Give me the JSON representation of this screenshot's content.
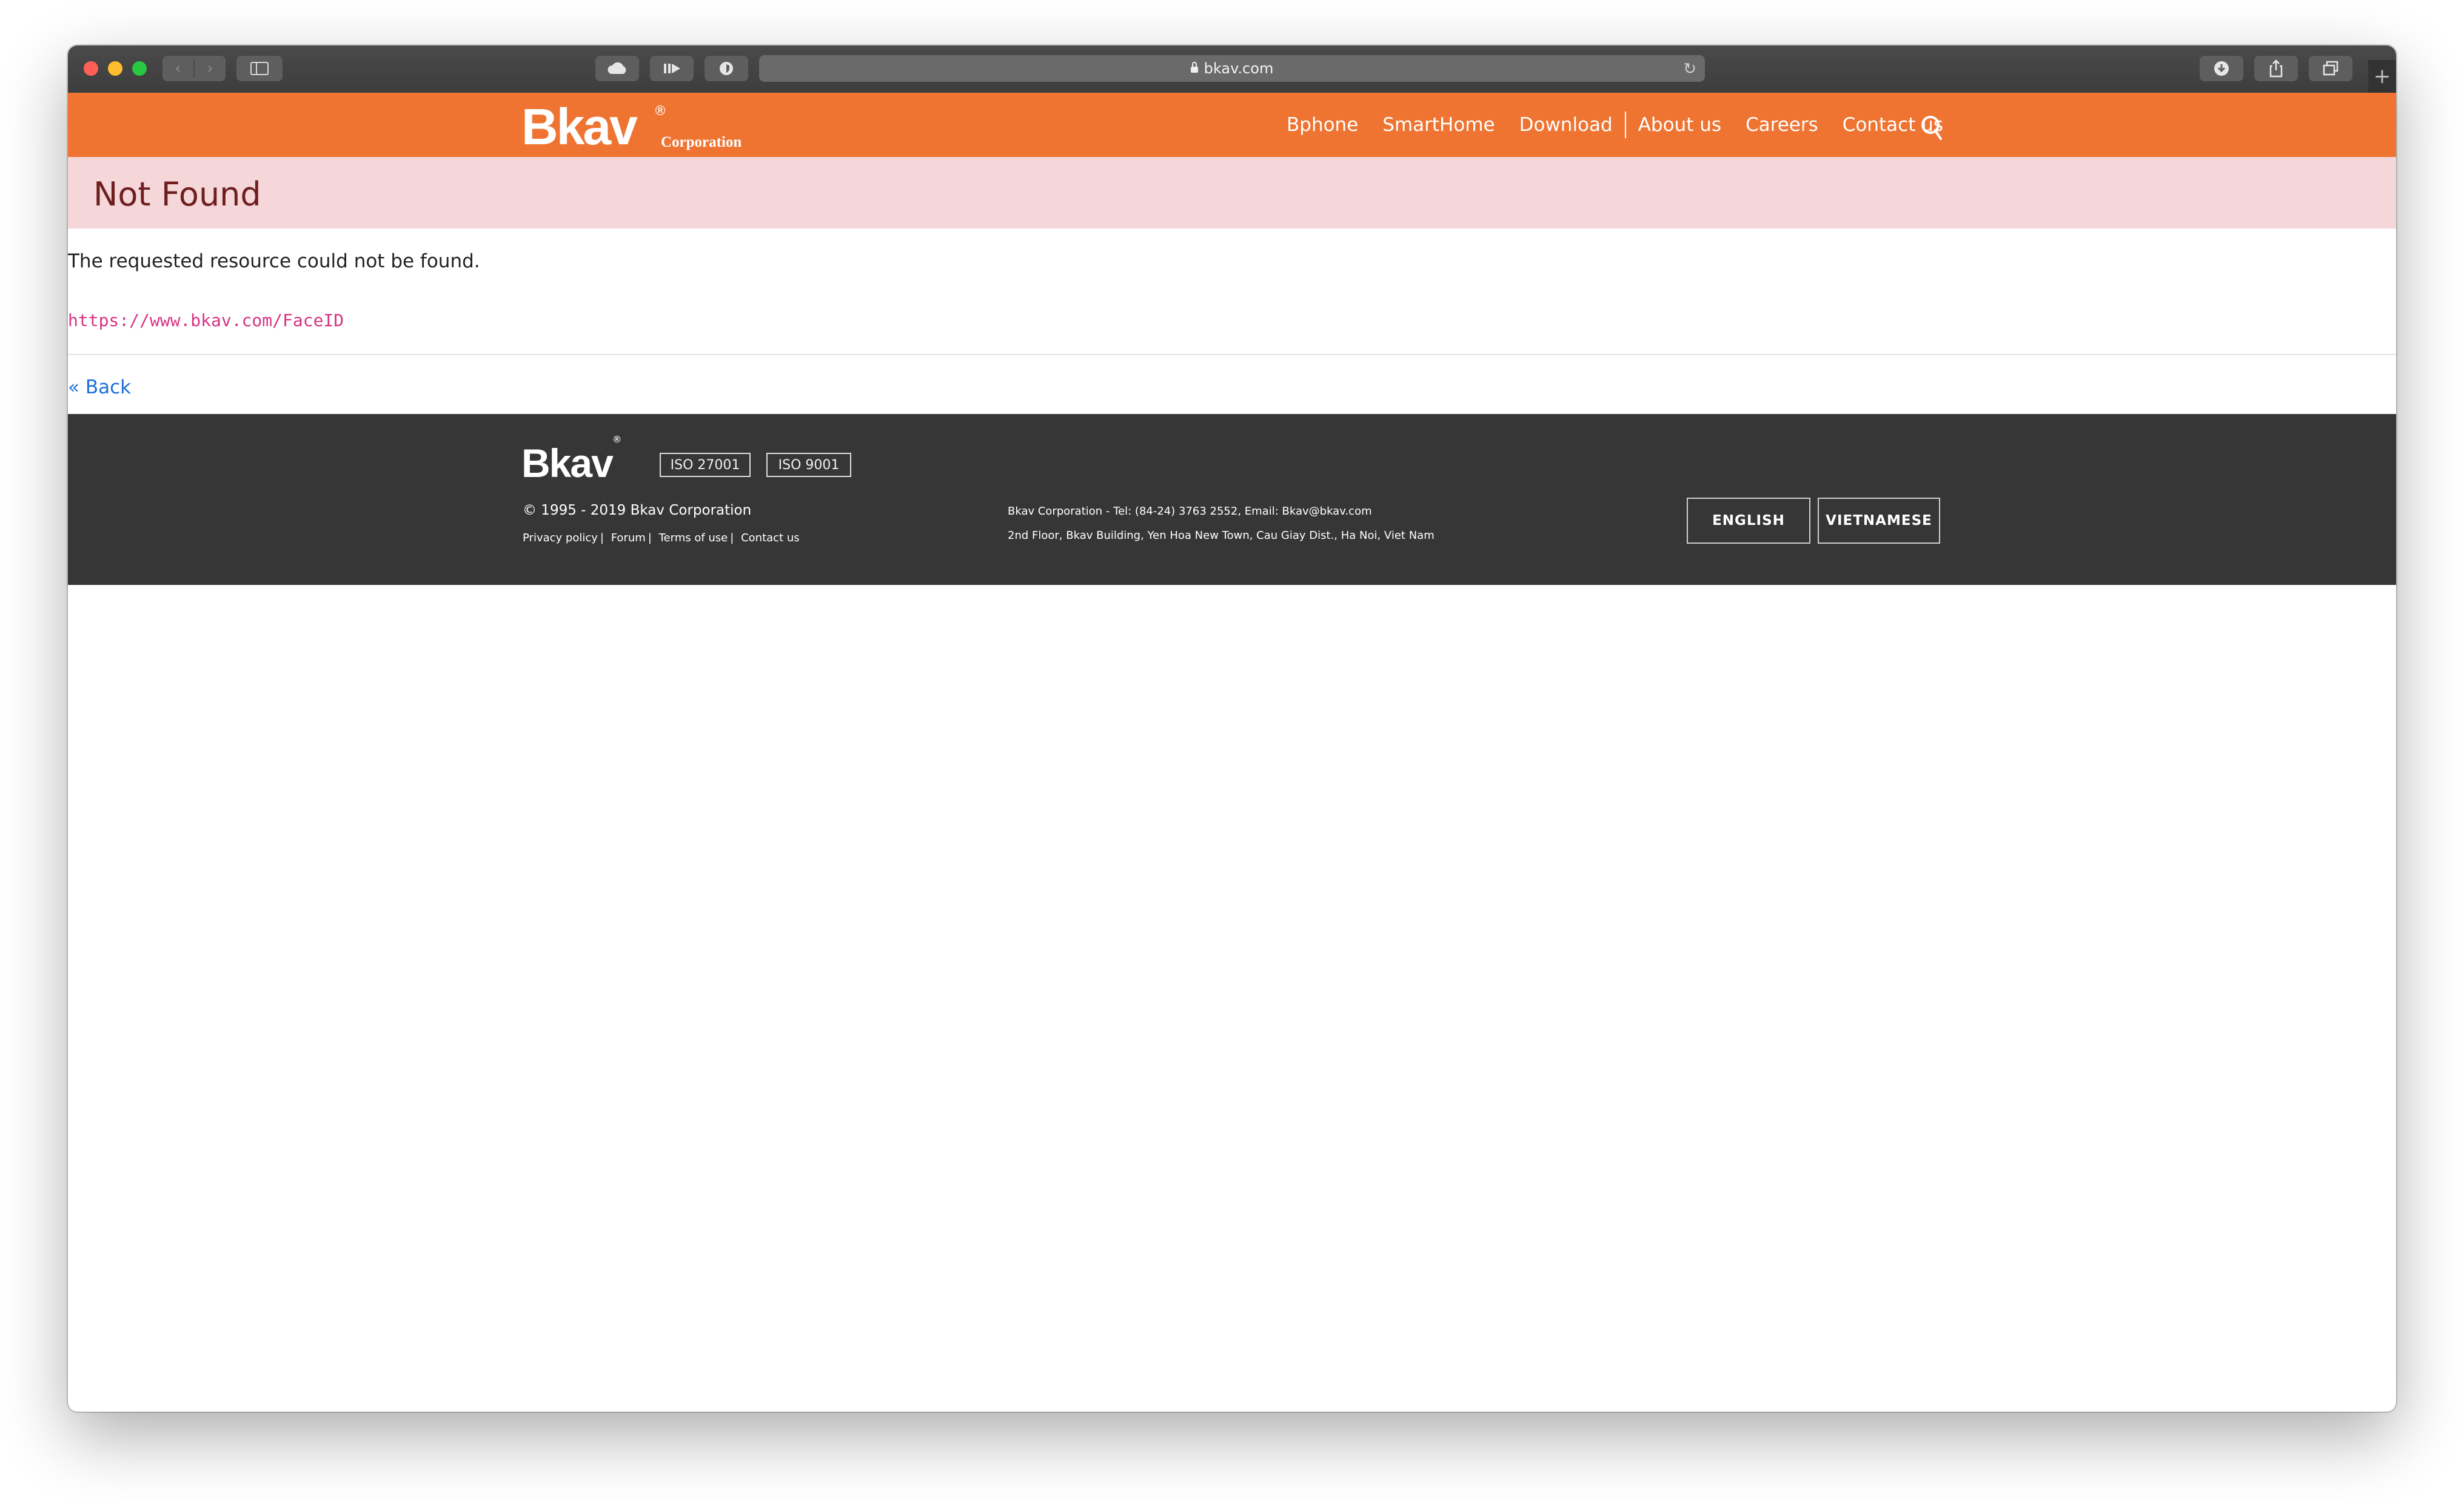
{
  "browser": {
    "address": "bkav.com",
    "nav_back": "‹",
    "nav_forward": "›",
    "reload": "↻",
    "new_tab": "+"
  },
  "header": {
    "logo_text": "Bkav",
    "logo_reg": "®",
    "logo_sub": "Corporation",
    "nav": [
      "Bphone",
      "SmartHome",
      "Download",
      "About us",
      "Careers",
      "Contact us"
    ],
    "bg_color": "#ef7432"
  },
  "error": {
    "title": "Not Found",
    "message": "The requested resource could not be found.",
    "url": "https://www.bkav.com/FaceID",
    "back_label": "« Back"
  },
  "footer": {
    "logo_text": "Bkav",
    "logo_reg": "®",
    "iso_badges": [
      "ISO 27001",
      "ISO 9001"
    ],
    "copyright": "© 1995 - 2019 Bkav Corporation",
    "links": [
      "Privacy policy",
      "Forum",
      "Terms of use",
      "Contact us"
    ],
    "contact_line1": "Bkav Corporation - Tel: (84-24) 3763 2552, Email: Bkav@bkav.com",
    "contact_line2": "2nd Floor, Bkav Building, Yen Hoa New Town, Cau Giay Dist., Ha Noi, Viet Nam",
    "languages": [
      "ENGLISH",
      "VIETNAMESE"
    ]
  }
}
